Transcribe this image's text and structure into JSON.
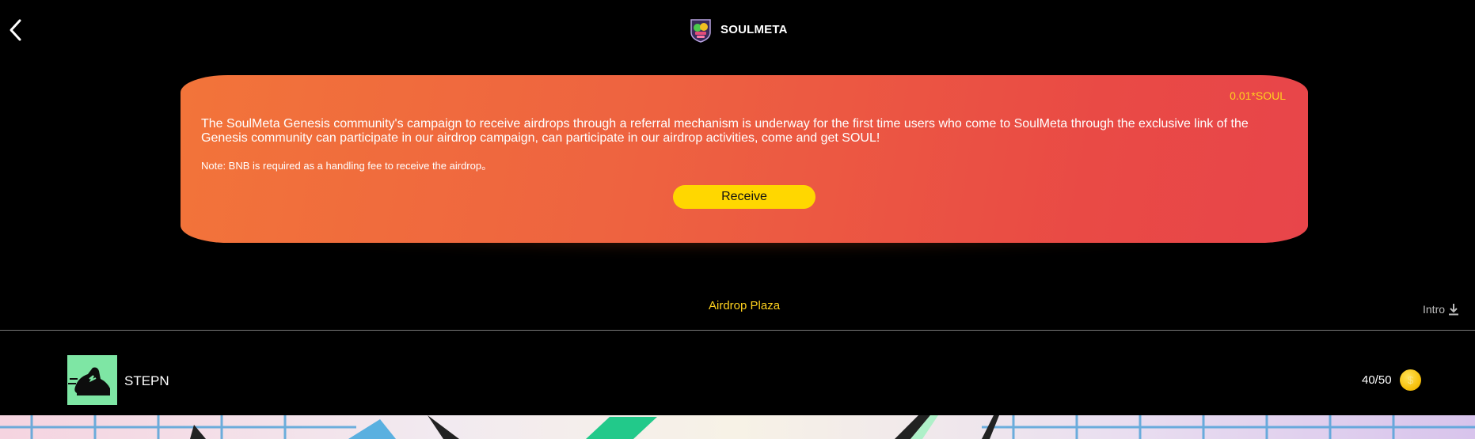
{
  "header": {
    "back_icon": "chevron-left-icon",
    "brand_name": "SOULMETA",
    "brand_logo": "soulmeta-logo"
  },
  "airdrop": {
    "reward": "0.01*SOUL",
    "description": "The SoulMeta Genesis community's campaign to receive airdrops through a referral mechanism is underway for the first time users who come to SoulMeta through the exclusive link of the Genesis community can participate in our airdrop campaign, can participate in our airdrop activities, come and get SOUL!",
    "note": "Note: BNB is required as a handling fee to receive the airdrop。",
    "receive_label": "Receive",
    "colors": {
      "gradient_start": "#f2743a",
      "gradient_end": "#e8454a",
      "button": "#ffd700",
      "reward_text": "#ffd21e"
    }
  },
  "tabs": {
    "plaza_label": "Airdrop Plaza",
    "intro_label": "Intro",
    "intro_icon": "download-icon"
  },
  "projects": [
    {
      "name": "STEPN",
      "logo": "stepn-sneaker-logo",
      "progress": "40/50",
      "claimed": 40,
      "total": 50,
      "coin_icon": "coin-icon",
      "coin_symbol": "$"
    }
  ]
}
